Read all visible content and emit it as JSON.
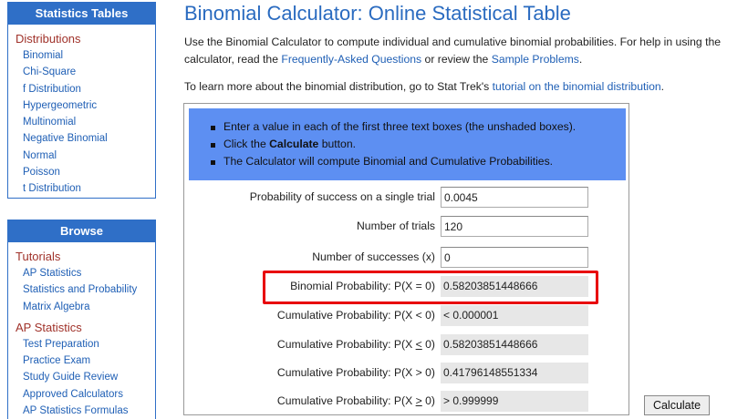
{
  "sidebar": {
    "stat_tables": {
      "header": "Statistics Tables",
      "section": "Distributions",
      "items": [
        "Binomial",
        "Chi-Square",
        "f Distribution",
        "Hypergeometric",
        "Multinomial",
        "Negative Binomial",
        "Normal",
        "Poisson",
        "t Distribution"
      ]
    },
    "browse": {
      "header": "Browse",
      "tutorials": {
        "section": "Tutorials",
        "items": [
          "AP Statistics",
          "Statistics and Probability",
          "Matrix Algebra"
        ]
      },
      "ap_statistics": {
        "section": "AP Statistics",
        "items": [
          "Test Preparation",
          "Practice Exam",
          "Study Guide Review",
          "Approved Calculators",
          "AP Statistics Formulas"
        ]
      }
    }
  },
  "main": {
    "title": "Binomial Calculator: Online Statistical Table",
    "intro": {
      "text1": "Use the Binomial Calculator to compute individual and cumulative binomial probabilities. For help in using the calculator, read the ",
      "link_faq": "Frequently-Asked Questions",
      "text2": " or review the ",
      "link_samples": "Sample Problems",
      "text3": "."
    },
    "learn": {
      "text1": "To learn more about the binomial distribution, go to Stat Trek's ",
      "link": "tutorial on the binomial distribution",
      "text2": "."
    }
  },
  "calculator": {
    "instructions": {
      "item1": "Enter a value in each of the first three text boxes (the unshaded boxes).",
      "item2_pre": "Click the ",
      "item2_bold": "Calculate",
      "item2_post": " button.",
      "item3": "The Calculator will compute Binomial and Cumulative Probabilities."
    },
    "inputs": {
      "prob_label": "Probability of success on a single trial",
      "prob_value": "0.0045",
      "trials_label": "Number of trials",
      "trials_value": "120",
      "successes_label": "Number of successes (x)",
      "successes_value": "0"
    },
    "outputs": {
      "binom_label": "Binomial Probability: P(X = 0)",
      "binom_value": "0.58203851448666",
      "cum_lt_label": "Cumulative Probability: P(X < 0)",
      "cum_lt_value": "< 0.000001",
      "cum_le_label_pre": "Cumulative Probability: P(X ",
      "cum_le_sym": "<",
      "cum_le_label_post": " 0)",
      "cum_le_value": "0.58203851448666",
      "cum_gt_label": "Cumulative Probability: P(X > 0)",
      "cum_gt_value": "0.41796148551334",
      "cum_ge_label_pre": "Cumulative Probability: P(X ",
      "cum_ge_sym": ">",
      "cum_ge_label_post": " 0)",
      "cum_ge_value": "> 0.999999"
    },
    "calculate_label": "Calculate",
    "highlight_color": "#e8000d"
  }
}
